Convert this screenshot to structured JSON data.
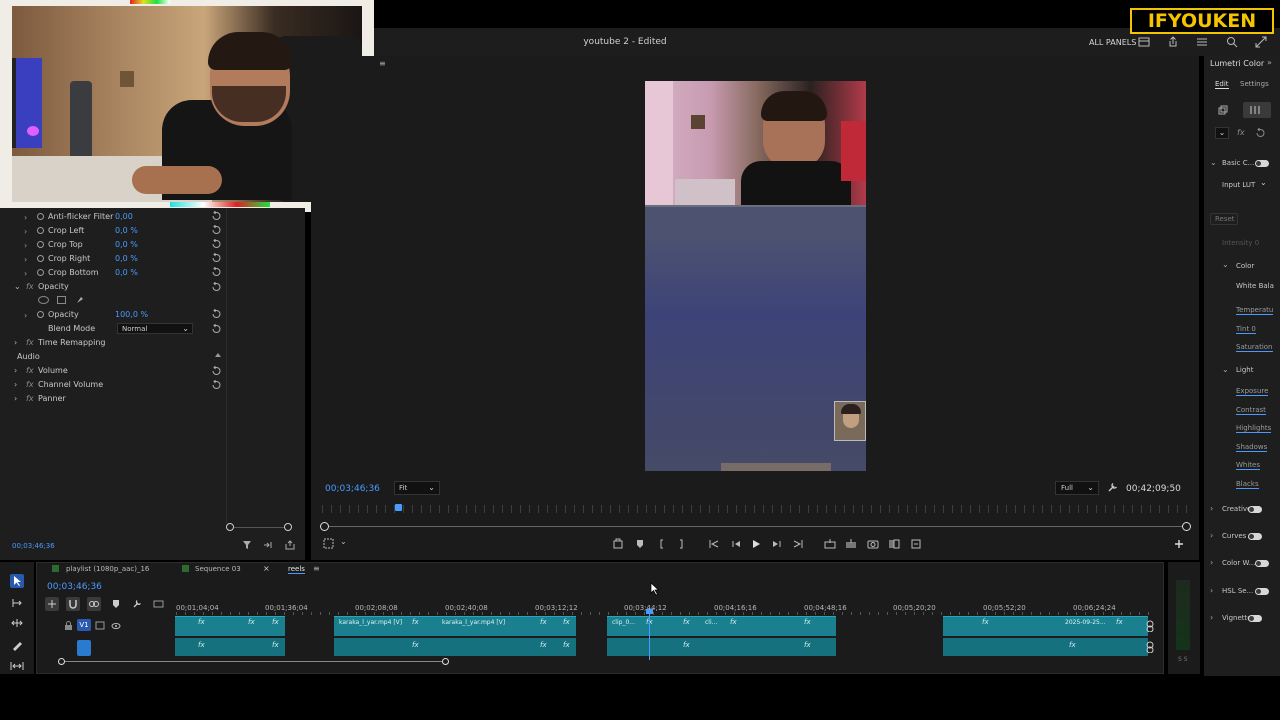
{
  "top": {
    "doc_title": "youtube 2 - Edited",
    "all_panels": "ALL PANELS"
  },
  "brand": {
    "text": "IFYOUKEN",
    "color": "#f5c400"
  },
  "effect_controls": {
    "rows": [
      {
        "label": "Anti-flicker Filter",
        "value": "0,00"
      },
      {
        "label": "Crop Left",
        "value": "0,0 %"
      },
      {
        "label": "Crop Top",
        "value": "0,0 %"
      },
      {
        "label": "Crop Right",
        "value": "0,0 %"
      },
      {
        "label": "Crop Bottom",
        "value": "0,0 %"
      }
    ],
    "opacity_section": "Opacity",
    "opacity_label": "Opacity",
    "opacity_value": "100,0 %",
    "blend_mode_label": "Blend Mode",
    "blend_mode_value": "Normal",
    "time_remapping": "Time Remapping",
    "audio_header": "Audio",
    "audio_rows": [
      "Volume",
      "Channel Volume",
      "Panner"
    ],
    "timecode": "00;03;46;36"
  },
  "program_monitor": {
    "timecode": "00;03;46;36",
    "fit": "Fit",
    "quality": "Full",
    "duration": "00;42;09;50"
  },
  "lumetri": {
    "title": "Lumetri Color",
    "tab_edit": "Edit",
    "tab_settings": "Settings",
    "basic_correction": "Basic C...",
    "input_lut": "Input LUT",
    "reset": "Reset",
    "intensity": "Intensity 0",
    "color": "Color",
    "white_balance": "White Bala",
    "temperature": "Temperatu",
    "tint": "Tint 0",
    "saturation": "Saturation",
    "light": "Light",
    "light_items": [
      "Exposure",
      "Contrast",
      "Highlights",
      "Shadows",
      "Whites",
      "Blacks"
    ],
    "sections": [
      "Creative",
      "Curves",
      "Color W...",
      "HSL Se...",
      "Vignette"
    ]
  },
  "timeline": {
    "tabs": [
      "playlist (1080p_aac)_16",
      "Sequence 03",
      "reels"
    ],
    "timecode": "00;03;46;36",
    "ruler": [
      "00;01;04;04",
      "00;01;36;04",
      "00;02;08;08",
      "00;02;40;08",
      "00;03;12;12",
      "00;03;44;12",
      "00;04;16;16",
      "00;04;48;16",
      "00;05;20;20",
      "00;05;52;20",
      "00;06;24;24"
    ],
    "track_v1": "V1",
    "clip_labels": [
      "karaka_l_yar.mp4 [V]",
      "karaka_l_yar.mp4 [V]",
      "clip_0...",
      "cli...",
      "2025-09-25..."
    ],
    "fx": "fx",
    "meter_label": "S S"
  }
}
